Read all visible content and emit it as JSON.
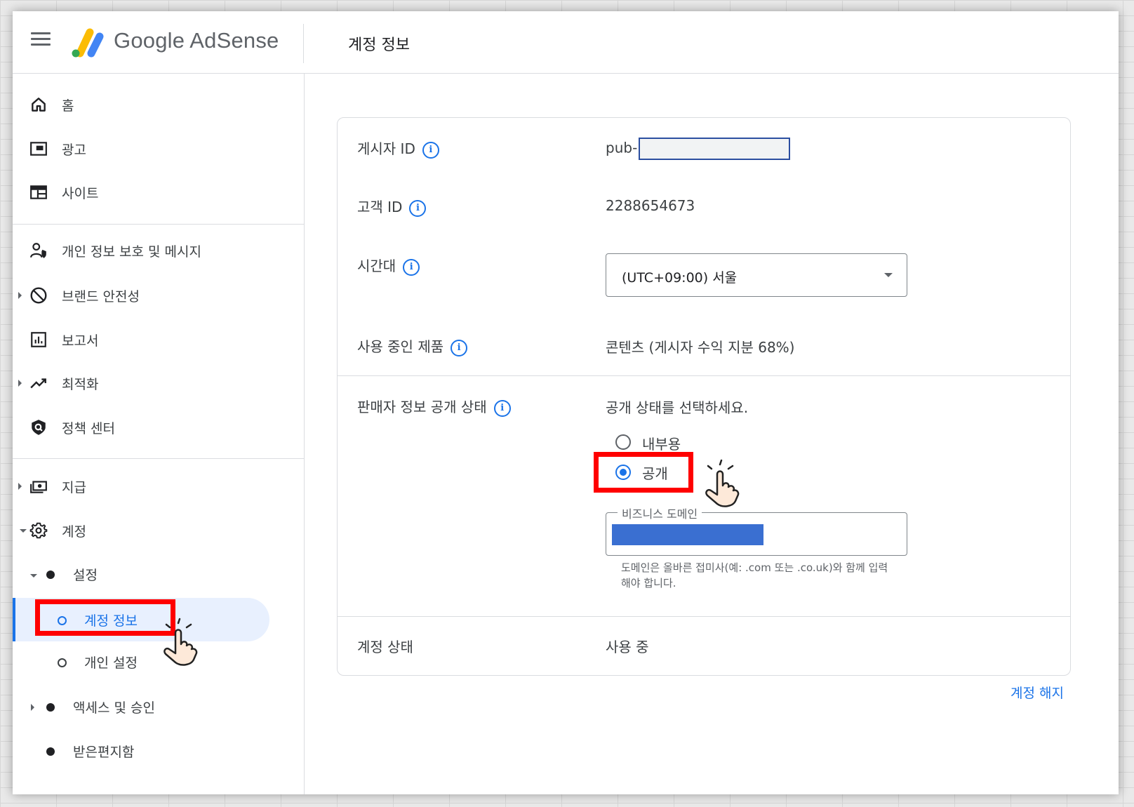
{
  "header": {
    "logo_text": "Google AdSense",
    "page_title": "계정 정보"
  },
  "sidebar": {
    "items": [
      {
        "label": "홈",
        "icon": "home-icon"
      },
      {
        "label": "광고",
        "icon": "ads-icon"
      },
      {
        "label": "사이트",
        "icon": "sites-icon"
      },
      {
        "label": "개인 정보 보호 및 메시지",
        "icon": "privacy-icon"
      },
      {
        "label": "브랜드 안전성",
        "icon": "block-icon"
      },
      {
        "label": "보고서",
        "icon": "reports-icon"
      },
      {
        "label": "최적화",
        "icon": "trend-icon"
      },
      {
        "label": "정책 센터",
        "icon": "policy-shield-icon"
      },
      {
        "label": "지급",
        "icon": "payments-icon"
      },
      {
        "label": "계정",
        "icon": "gear-icon"
      }
    ],
    "sub_items": [
      {
        "label": "설정"
      },
      {
        "label": "계정 정보"
      },
      {
        "label": "개인 설정"
      },
      {
        "label": "액세스 및 승인"
      },
      {
        "label": "받은편지함"
      }
    ]
  },
  "account": {
    "publisher_id_label": "게시자 ID",
    "publisher_id_prefix": "pub-",
    "customer_id_label": "고객 ID",
    "customer_id_value": "2288654673",
    "timezone_label": "시간대",
    "timezone_value": "(UTC+09:00) 서울",
    "products_label": "사용 중인 제품",
    "products_value": "콘텐츠 (게시자 수익 지분 68%)",
    "seller_label": "판매자 정보 공개 상태",
    "seller_prompt": "공개 상태를 선택하세요.",
    "radio_internal": "내부용",
    "radio_public": "공개",
    "domain_legend": "비즈니스 도메인",
    "domain_helper": "도메인은 올바른 접미사(예: .com 또는 .co.uk)와 함께 입력해야 합니다.",
    "status_label": "계정 상태",
    "status_value": "사용 중",
    "terminate": "계정 해지",
    "info_glyph": "i"
  },
  "colors": {
    "accent": "#1a73e8",
    "highlight": "#ff0000",
    "active_bg": "#e8f0fe"
  }
}
